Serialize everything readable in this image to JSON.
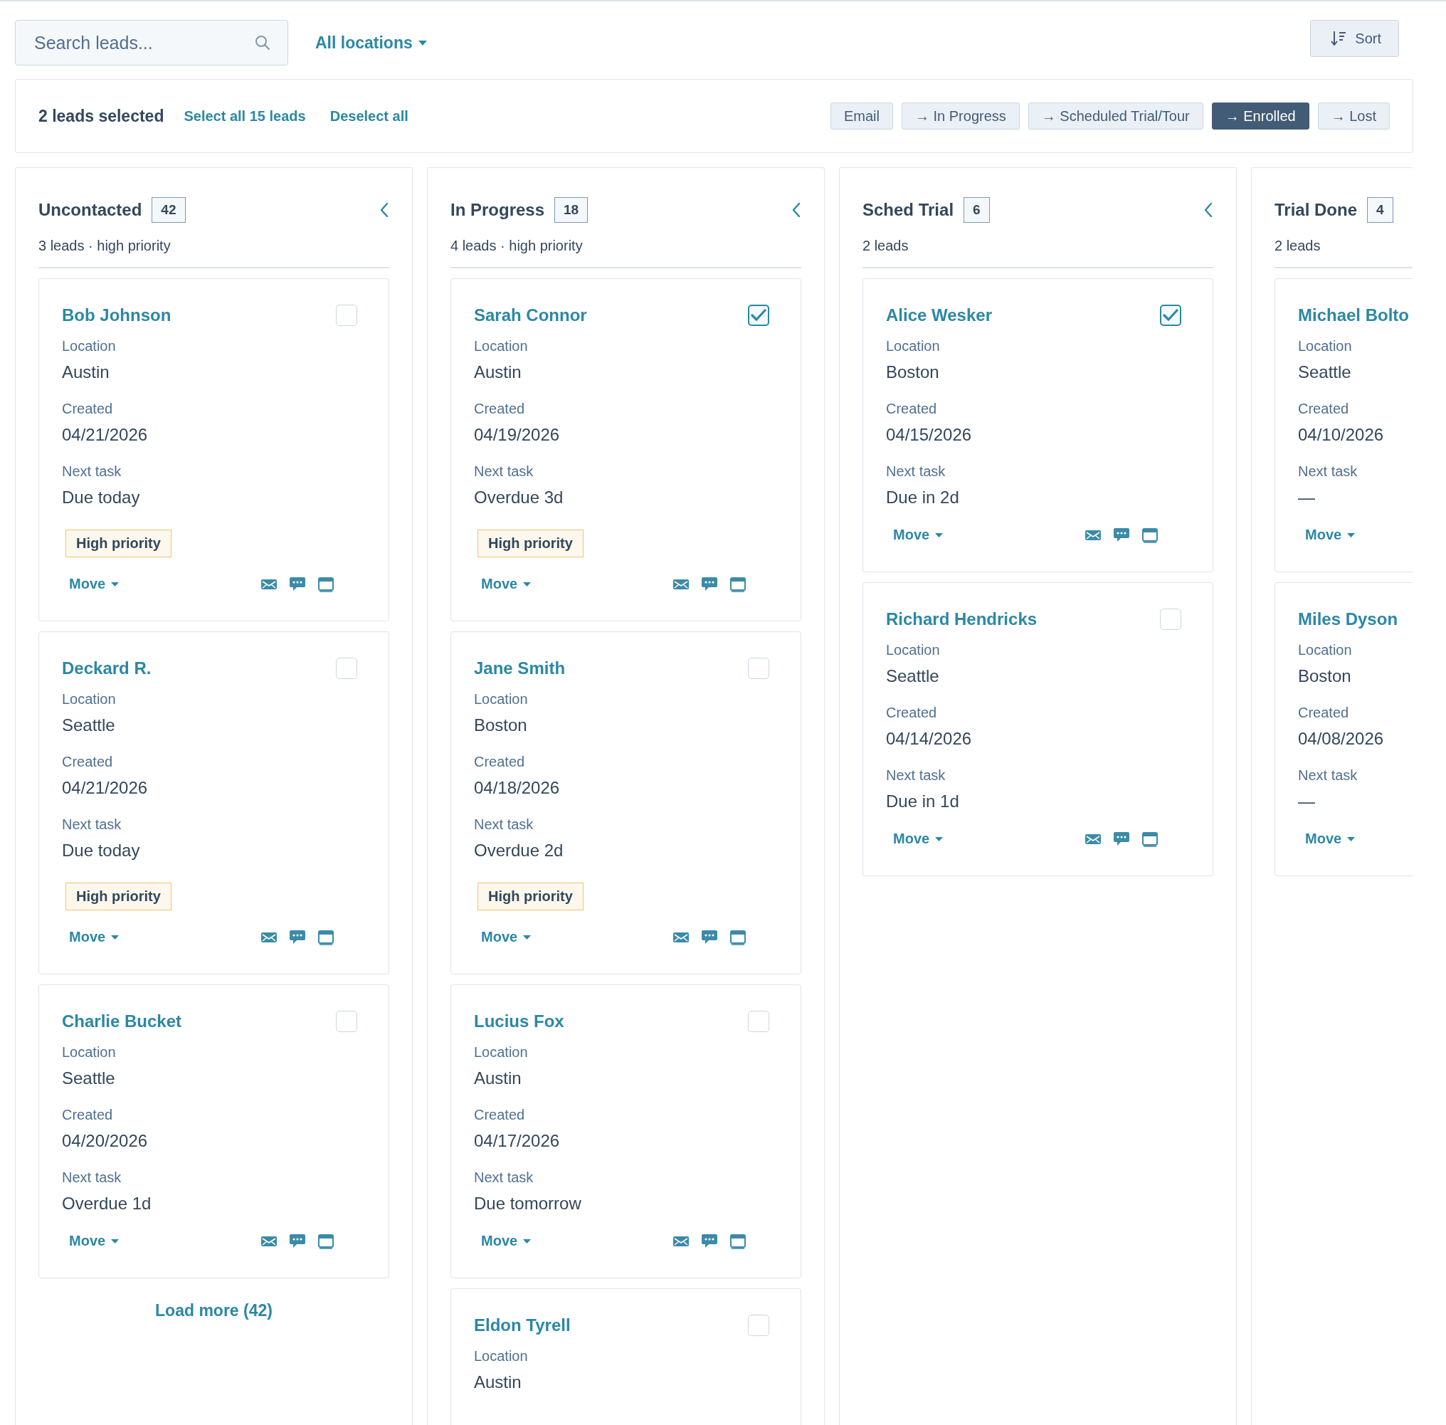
{
  "search": {
    "placeholder": "Search leads..."
  },
  "location_filter": {
    "label": "All locations"
  },
  "sort_button": {
    "label": "Sort"
  },
  "selection_bar": {
    "summary": "2 leads selected",
    "select_all": "Select all 15 leads",
    "deselect_all": "Deselect all",
    "actions": [
      {
        "label": "Email",
        "selected": false
      },
      {
        "label": "→ In Progress",
        "selected": false
      },
      {
        "label": "→ Scheduled Trial/Tour",
        "selected": false
      },
      {
        "label": "→ Enrolled",
        "selected": true
      },
      {
        "label": "→ Lost",
        "selected": false
      }
    ]
  },
  "columns": [
    {
      "title": "Uncontacted",
      "count": "42",
      "subtitle": "3 leads · high priority",
      "partial": false,
      "load_more": "Load more (42)",
      "cards": [
        {
          "name": "Bob Johnson",
          "checked": false,
          "fields": [
            {
              "label": "Location",
              "value": "Austin"
            },
            {
              "label": "Created",
              "value": "04/21/2026"
            },
            {
              "label": "Next task",
              "value": "Due today"
            }
          ],
          "tag": "High priority",
          "move": "Move"
        },
        {
          "name": "Deckard R.",
          "checked": false,
          "fields": [
            {
              "label": "Location",
              "value": "Seattle"
            },
            {
              "label": "Created",
              "value": "04/21/2026"
            },
            {
              "label": "Next task",
              "value": "Due today"
            }
          ],
          "tag": "High priority",
          "move": "Move"
        },
        {
          "name": "Charlie Bucket",
          "checked": false,
          "fields": [
            {
              "label": "Location",
              "value": "Seattle"
            },
            {
              "label": "Created",
              "value": "04/20/2026"
            },
            {
              "label": "Next task",
              "value": "Overdue 1d"
            }
          ],
          "move": "Move"
        }
      ]
    },
    {
      "title": "In Progress",
      "count": "18",
      "subtitle": "4 leads · high priority",
      "partial": false,
      "cards": [
        {
          "name": "Sarah Connor",
          "checked": true,
          "fields": [
            {
              "label": "Location",
              "value": "Austin"
            },
            {
              "label": "Created",
              "value": "04/19/2026"
            },
            {
              "label": "Next task",
              "value": "Overdue 3d"
            }
          ],
          "tag": "High priority",
          "move": "Move"
        },
        {
          "name": "Jane Smith",
          "checked": false,
          "fields": [
            {
              "label": "Location",
              "value": "Boston"
            },
            {
              "label": "Created",
              "value": "04/18/2026"
            },
            {
              "label": "Next task",
              "value": "Overdue 2d"
            }
          ],
          "tag": "High priority",
          "move": "Move"
        },
        {
          "name": "Lucius Fox",
          "checked": false,
          "fields": [
            {
              "label": "Location",
              "value": "Austin"
            },
            {
              "label": "Created",
              "value": "04/17/2026"
            },
            {
              "label": "Next task",
              "value": "Due tomorrow"
            }
          ],
          "move": "Move"
        },
        {
          "name": "Eldon Tyrell",
          "checked": false,
          "fields": [
            {
              "label": "Location",
              "value": "Austin"
            }
          ]
        }
      ]
    },
    {
      "title": "Sched Trial",
      "count": "6",
      "subtitle": "2 leads",
      "partial": false,
      "cards": [
        {
          "name": "Alice Wesker",
          "checked": true,
          "fields": [
            {
              "label": "Location",
              "value": "Boston"
            },
            {
              "label": "Created",
              "value": "04/15/2026"
            },
            {
              "label": "Next task",
              "value": "Due in 2d"
            }
          ],
          "move": "Move"
        },
        {
          "name": "Richard Hendricks",
          "checked": false,
          "fields": [
            {
              "label": "Location",
              "value": "Seattle"
            },
            {
              "label": "Created",
              "value": "04/14/2026"
            },
            {
              "label": "Next task",
              "value": "Due in 1d"
            }
          ],
          "move": "Move"
        }
      ]
    },
    {
      "title": "Trial Done",
      "count": "4",
      "subtitle": "2 leads",
      "partial": true,
      "cards": [
        {
          "name": "Michael Bolto",
          "fields": [
            {
              "label": "Location",
              "value": "Seattle"
            },
            {
              "label": "Created",
              "value": "04/10/2026"
            },
            {
              "label": "Next task",
              "value": "—"
            }
          ],
          "move": "Move"
        },
        {
          "name": "Miles Dyson",
          "fields": [
            {
              "label": "Location",
              "value": "Boston"
            },
            {
              "label": "Created",
              "value": "04/08/2026"
            },
            {
              "label": "Next task",
              "value": "—"
            }
          ],
          "move": "Move"
        }
      ]
    }
  ]
}
